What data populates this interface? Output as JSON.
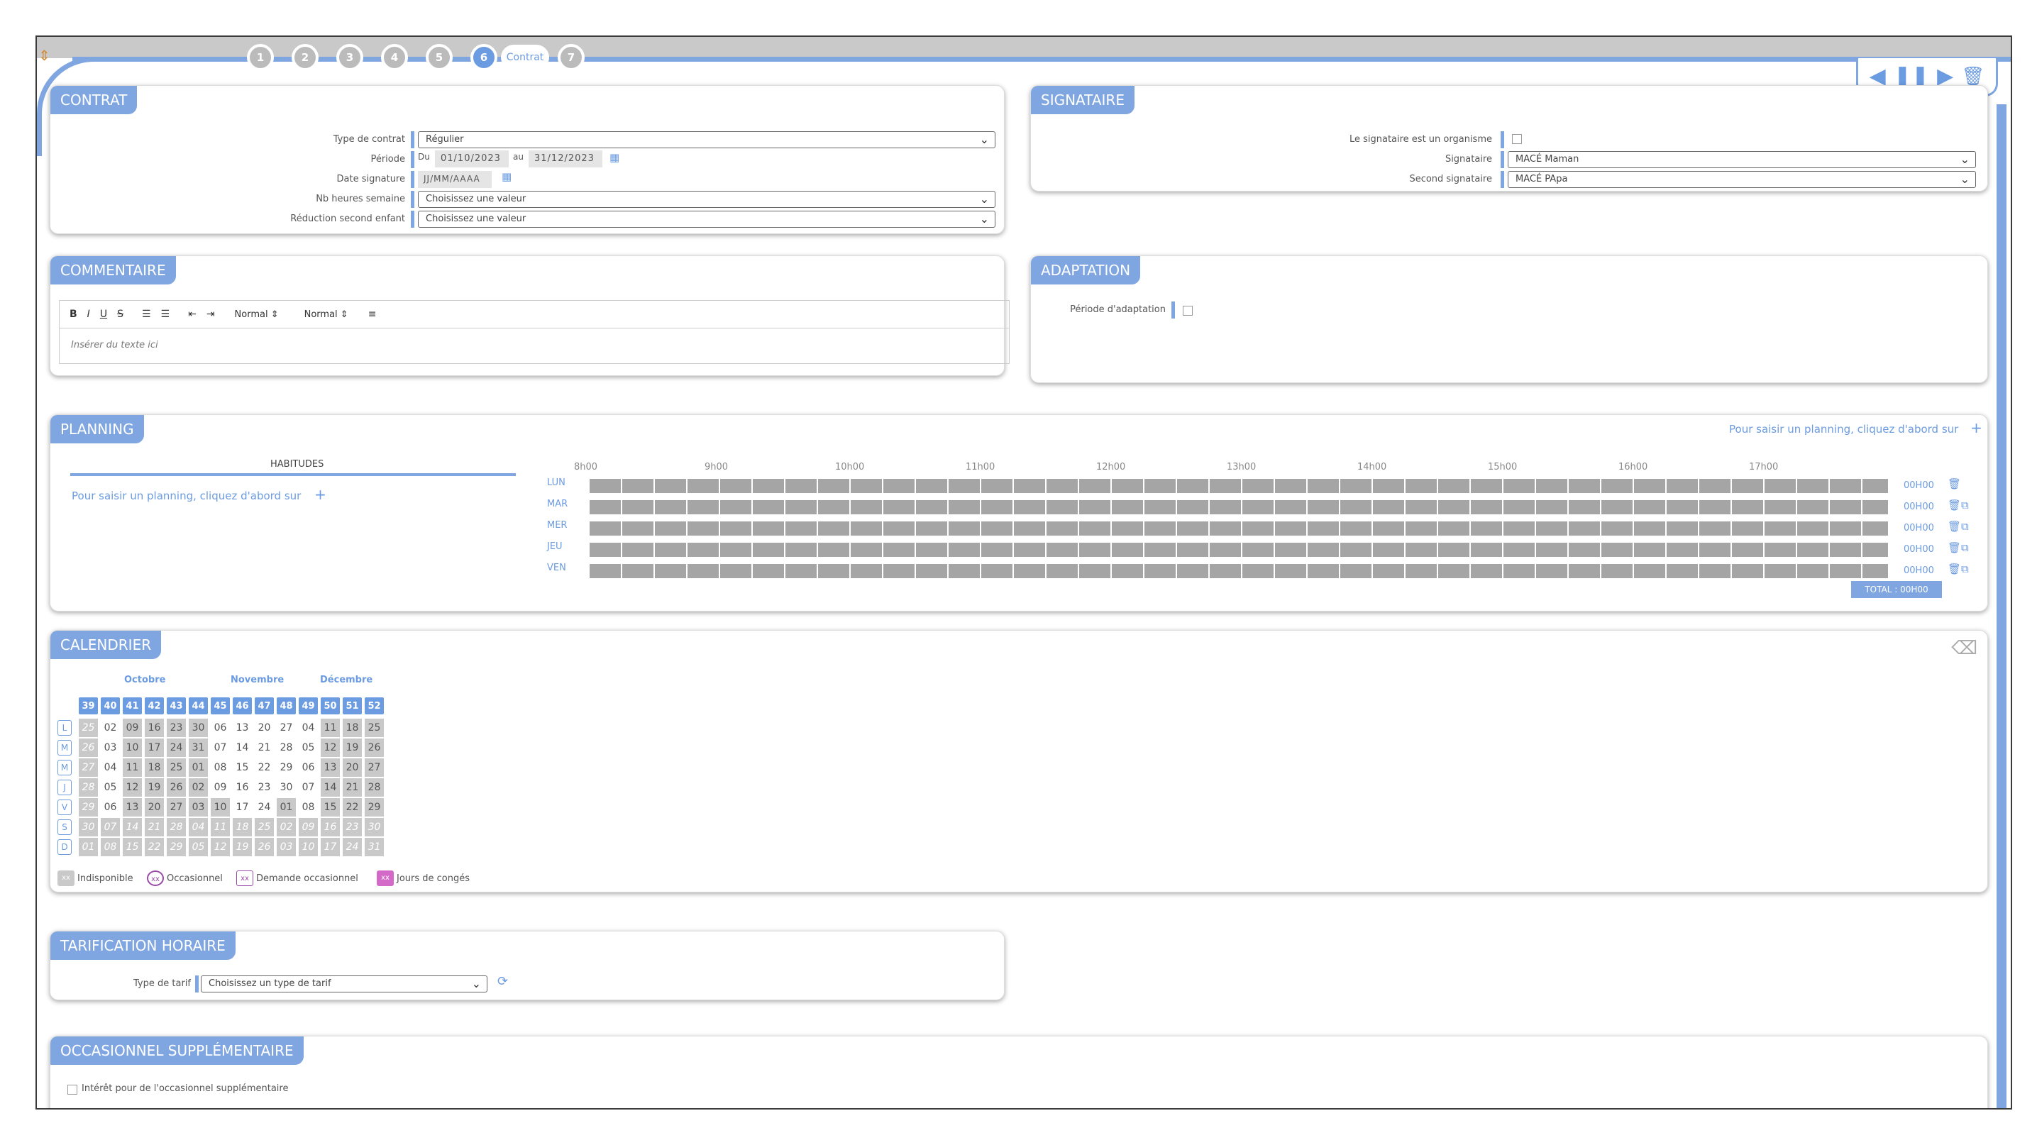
{
  "wizard": {
    "steps": [
      "1",
      "2",
      "3",
      "4",
      "5",
      "6",
      "7"
    ],
    "active_step_label": "Contrat"
  },
  "nav_icons": [
    "prev-icon",
    "pause-icon",
    "next-icon",
    "trash-icon"
  ],
  "contrat": {
    "title": "CONTRAT",
    "type_label": "Type de contrat",
    "type_value": "Régulier",
    "periode_label": "Période",
    "du": "Du",
    "date_from": "01/10/2023",
    "au": "au",
    "date_to": "31/12/2023",
    "date_sig_label": "Date signature",
    "date_sig_placeholder": "JJ/MM/AAAA",
    "nb_heures_label": "Nb heures semaine",
    "nb_heures_value": "Choisissez une valeur",
    "reduction_label": "Réduction second enfant",
    "reduction_value": "Choisissez une valeur"
  },
  "signataire": {
    "title": "SIGNATAIRE",
    "organisme_label": "Le signataire est un organisme",
    "signataire_label": "Signataire",
    "signataire_value": "MACÉ Maman",
    "second_label": "Second signataire",
    "second_value": "MACÉ PApa"
  },
  "commentaire": {
    "title": "COMMENTAIRE",
    "tools": [
      "B",
      "I",
      "U",
      "S"
    ],
    "size_select": "Normal",
    "font_select": "Normal",
    "placeholder": "Insérer du texte ici"
  },
  "adaptation": {
    "title": "ADAPTATION",
    "periode_label": "Période d'adaptation"
  },
  "planning": {
    "title": "PLANNING",
    "top_link": "Pour saisir un planning, cliquez d'abord sur",
    "habitudes_header": "HABITUDES",
    "left_link": "Pour saisir un planning, cliquez d'abord sur",
    "hours": [
      "8h00",
      "9h00",
      "10h00",
      "11h00",
      "12h00",
      "13h00",
      "14h00",
      "15h00",
      "16h00",
      "17h00"
    ],
    "days": [
      {
        "label": "LUN",
        "duration": "00H00"
      },
      {
        "label": "MAR",
        "duration": "00H00"
      },
      {
        "label": "MER",
        "duration": "00H00"
      },
      {
        "label": "JEU",
        "duration": "00H00"
      },
      {
        "label": "VEN",
        "duration": "00H00"
      }
    ],
    "total": "TOTAL : 00H00"
  },
  "calendrier": {
    "title": "CALENDRIER",
    "months": [
      "Octobre",
      "Novembre",
      "Décembre"
    ],
    "weeks": [
      "39",
      "40",
      "41",
      "42",
      "43",
      "44",
      "45",
      "46",
      "47",
      "48",
      "49",
      "50",
      "51",
      "52"
    ],
    "day_letters": [
      "L",
      "M",
      "M",
      "J",
      "V",
      "S",
      "D"
    ],
    "rows": [
      [
        "25",
        "02",
        "09",
        "16",
        "23",
        "30",
        "06",
        "13",
        "20",
        "27",
        "04",
        "11",
        "18",
        "25"
      ],
      [
        "26",
        "03",
        "10",
        "17",
        "24",
        "31",
        "07",
        "14",
        "21",
        "28",
        "05",
        "12",
        "19",
        "26"
      ],
      [
        "27",
        "04",
        "11",
        "18",
        "25",
        "01",
        "08",
        "15",
        "22",
        "29",
        "06",
        "13",
        "20",
        "27"
      ],
      [
        "28",
        "05",
        "12",
        "19",
        "26",
        "02",
        "09",
        "16",
        "23",
        "30",
        "07",
        "14",
        "21",
        "28"
      ],
      [
        "29",
        "06",
        "13",
        "20",
        "27",
        "03",
        "10",
        "17",
        "24",
        "01",
        "08",
        "15",
        "22",
        "29"
      ],
      [
        "30",
        "07",
        "14",
        "21",
        "28",
        "04",
        "11",
        "18",
        "25",
        "02",
        "09",
        "16",
        "23",
        "30"
      ],
      [
        "01",
        "08",
        "15",
        "22",
        "29",
        "05",
        "12",
        "19",
        "26",
        "03",
        "10",
        "17",
        "24",
        "31"
      ]
    ],
    "legend": [
      "Indisponible",
      "Occasionnel",
      "Demande occasionnel",
      "Jours de congés"
    ],
    "legend_marks": [
      "xx",
      "xx",
      "xx",
      "xx"
    ]
  },
  "tarification": {
    "title": "TARIFICATION HORAIRE",
    "type_label": "Type de tarif",
    "type_value": "Choisissez un type de tarif"
  },
  "occasionnel": {
    "title": "OCCASIONNEL SUPPLÉMENTAIRE",
    "interet_label": "Intérêt pour de l'occasionnel supplémentaire"
  }
}
